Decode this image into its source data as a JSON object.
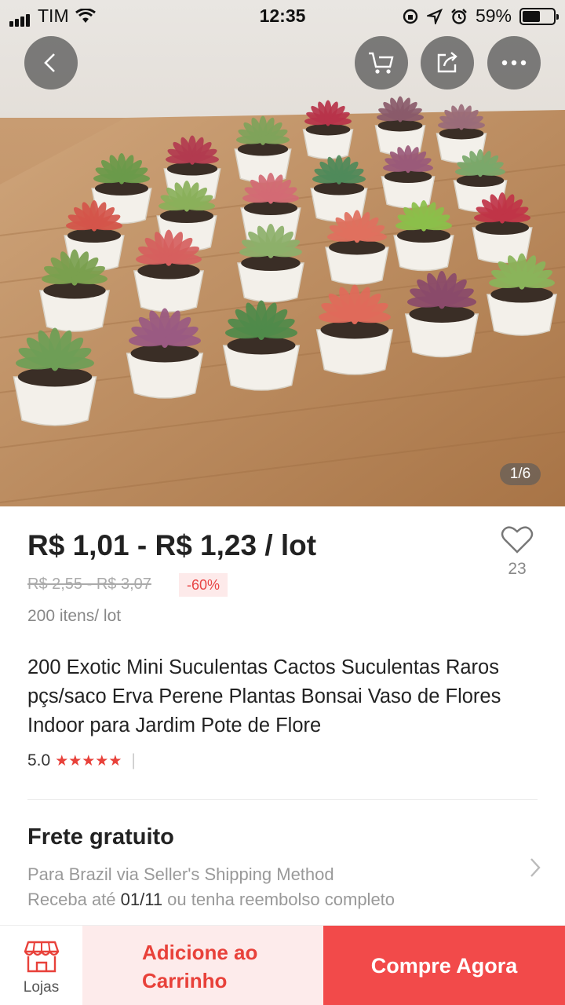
{
  "status_bar": {
    "carrier": "TIM",
    "time": "12:35",
    "battery": "59%",
    "battery_level": 0.59,
    "icons": [
      "signal-icon",
      "wifi-icon",
      "orientation-lock-icon",
      "location-icon",
      "alarm-icon",
      "battery-icon"
    ]
  },
  "gallery": {
    "counter": "1/6",
    "buttons": [
      "back-icon",
      "cart-icon",
      "share-icon",
      "more-icon"
    ]
  },
  "product": {
    "price": "R$ 1,01 - R$ 1,23 / lot",
    "original_price": "R$ 2,55 - R$ 3,07",
    "discount": "-60%",
    "lot_info": "200 itens/ lot",
    "wishlist_count": "23",
    "title": "200 Exotic Mini Suculentas Cactos Suculentas Raros pçs/saco Erva Perene Plantas Bonsai Vaso de Flores Indoor para Jardim Pote de Flore",
    "rating": "5.0",
    "stars": "★★★★★",
    "rating_separator": "|"
  },
  "shipping": {
    "title": "Frete gratuito",
    "method": "Para Brazil via Seller's Shipping Method",
    "delivery_prefix": "Receba até ",
    "delivery_date": "01/11",
    "delivery_suffix": " ou tenha reembolso completo"
  },
  "bottom_bar": {
    "stores_label": "Lojas",
    "add_to_cart": "Adicione ao Carrinho",
    "buy_now": "Compre Agora"
  },
  "colors": {
    "accent": "#f24a4a",
    "accent_light": "#fdebeb",
    "star": "#e8413a"
  }
}
